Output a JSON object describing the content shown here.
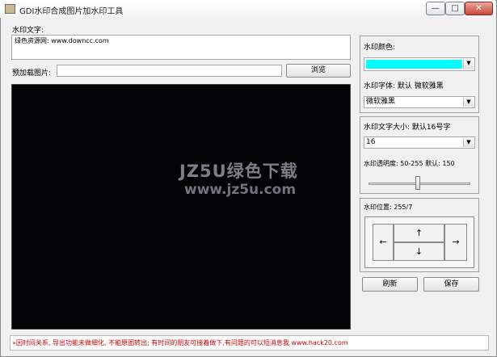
{
  "window": {
    "title": "GDI水印合成图片加水印工具"
  },
  "titlebar_buttons": {
    "minimize": "—",
    "maximize": "□",
    "close": "✕"
  },
  "left": {
    "text_label": "水印文字:",
    "text_value": "绿色资源网: www.downcc.com",
    "preload_label": "预加载图片:",
    "preload_value": "",
    "browse_label": "浏览"
  },
  "preview": {
    "watermark_main": "JZ5U绿色下载",
    "watermark_url": "www.jz5u.com"
  },
  "right": {
    "color_label": "水印颜色:",
    "color_value": "#00ffff",
    "font_label": "水印字体: 默认 微软雅黑",
    "font_value": "微软雅黑",
    "size_label": "水印文字大小: 默认16号字",
    "size_value": "16",
    "opacity_label": "水印透明度: 50-255 默认: 150",
    "opacity_value": 150,
    "opacity_min": 50,
    "opacity_max": 255,
    "position_label": "水印位置: 255/7",
    "arrows": {
      "left": "←",
      "up": "↑",
      "down": "↓",
      "right": "→"
    },
    "refresh_label": "刷新",
    "save_label": "保存"
  },
  "status": {
    "text": "»因时间关系, 导出功能未做细化, 不能原图转出; 有时间的朋友可接着做下,有问题的可以短消息我 www.hack20.com",
    "color": "#cc0000"
  }
}
